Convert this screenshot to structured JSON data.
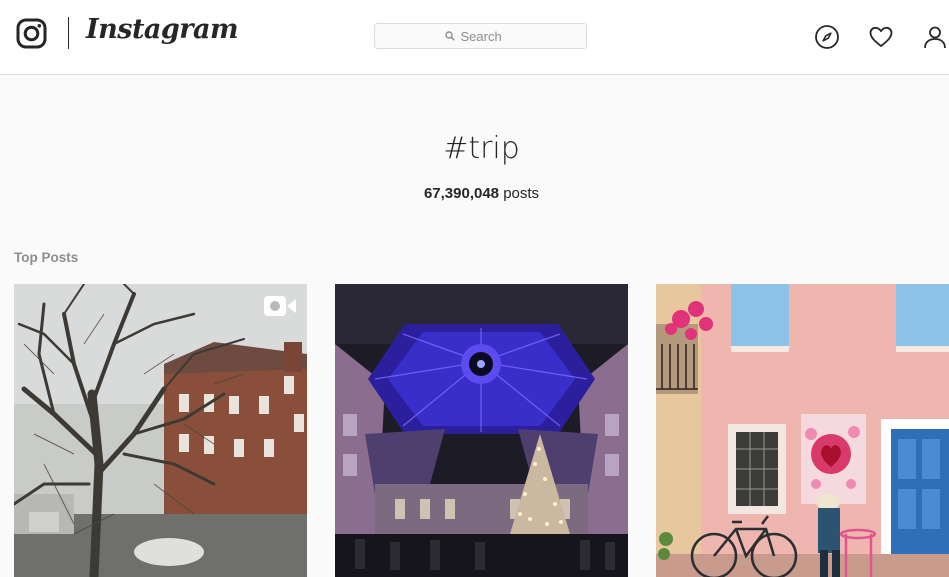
{
  "header": {
    "brand": "Instagram",
    "search": {
      "placeholder": "Search",
      "value": ""
    },
    "icons": [
      "instagram-glyph-icon",
      "search-icon",
      "compass-icon",
      "heart-icon",
      "user-icon"
    ]
  },
  "hashtag": {
    "title": "#trip",
    "post_count": "67,390,048",
    "post_unit": "posts"
  },
  "top_posts": {
    "label": "Top Posts",
    "items": [
      {
        "kind": "video",
        "icon": "video-camera-icon"
      },
      {
        "kind": "photo"
      },
      {
        "kind": "photo"
      }
    ]
  },
  "colors": {
    "background": "#fafafa",
    "text": "#262626",
    "muted": "#8e8e8e",
    "border": "#dbdbdb"
  }
}
